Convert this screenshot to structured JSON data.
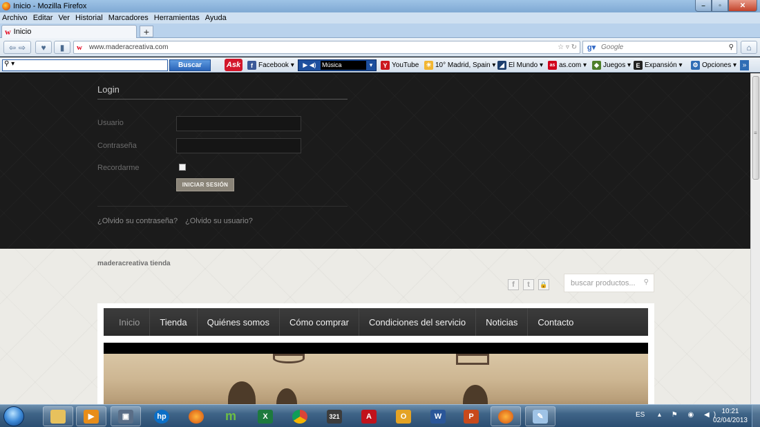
{
  "window": {
    "title": "Inicio - Mozilla Firefox"
  },
  "menubar": [
    "Archivo",
    "Editar",
    "Ver",
    "Historial",
    "Marcadores",
    "Herramientas",
    "Ayuda"
  ],
  "tab": {
    "label": "Inicio",
    "favicon": "w"
  },
  "url": "www.maderacreativa.com",
  "search_engine_placeholder": "Google",
  "toolbar": {
    "ask_button": "Buscar",
    "ask_logo": "Ask",
    "music_label": "Música",
    "bookmarks": [
      {
        "label": "Facebook ▾",
        "icon": "facebook-icon",
        "color": "#3b5998",
        "glyph": "f"
      },
      {
        "label": "YouTube",
        "icon": "youtube-icon",
        "color": "#cc181e",
        "glyph": "Y"
      },
      {
        "label": "10° Madrid, Spain ▾",
        "icon": "weather-icon",
        "color": "#f2b632",
        "glyph": "☀"
      },
      {
        "label": "El Mundo ▾",
        "icon": "elmundo-icon",
        "color": "#1d3f6e",
        "glyph": "◢"
      },
      {
        "label": "as.com ▾",
        "icon": "as-icon",
        "color": "#d1001c",
        "glyph": "as"
      },
      {
        "label": "Juegos ▾",
        "icon": "games-icon",
        "color": "#4d7f2a",
        "glyph": "◆"
      },
      {
        "label": "Expansión ▾",
        "icon": "expansion-icon",
        "color": "#222222",
        "glyph": "E"
      },
      {
        "label": "Opciones ▾",
        "icon": "options-icon",
        "color": "#2f6db5",
        "glyph": "⚙"
      }
    ]
  },
  "login": {
    "title": "Login",
    "username_label": "Usuario",
    "password_label": "Contraseña",
    "remember_label": "Recordarme",
    "submit_label": "INICIAR SESIÓN",
    "forgot_password": "¿Olvido su contraseña?",
    "forgot_username": "¿Olvido su usuario?"
  },
  "site": {
    "name": "maderacreativa tienda",
    "search_placeholder": "buscar productos...",
    "social": [
      "f",
      "t",
      "🔒"
    ]
  },
  "nav": [
    "Inicio",
    "Tienda",
    "Quiénes somos",
    "Cómo comprar",
    "Condiciones del servicio",
    "Noticias",
    "Contacto"
  ],
  "taskbar": {
    "language": "ES",
    "time": "10:21",
    "date": "02/04/2013"
  },
  "colors": {
    "login_bg": "#1b1b1b",
    "nav_bg": "#333333",
    "button_bg": "#8a8478",
    "taskbar": "#3f6487"
  }
}
